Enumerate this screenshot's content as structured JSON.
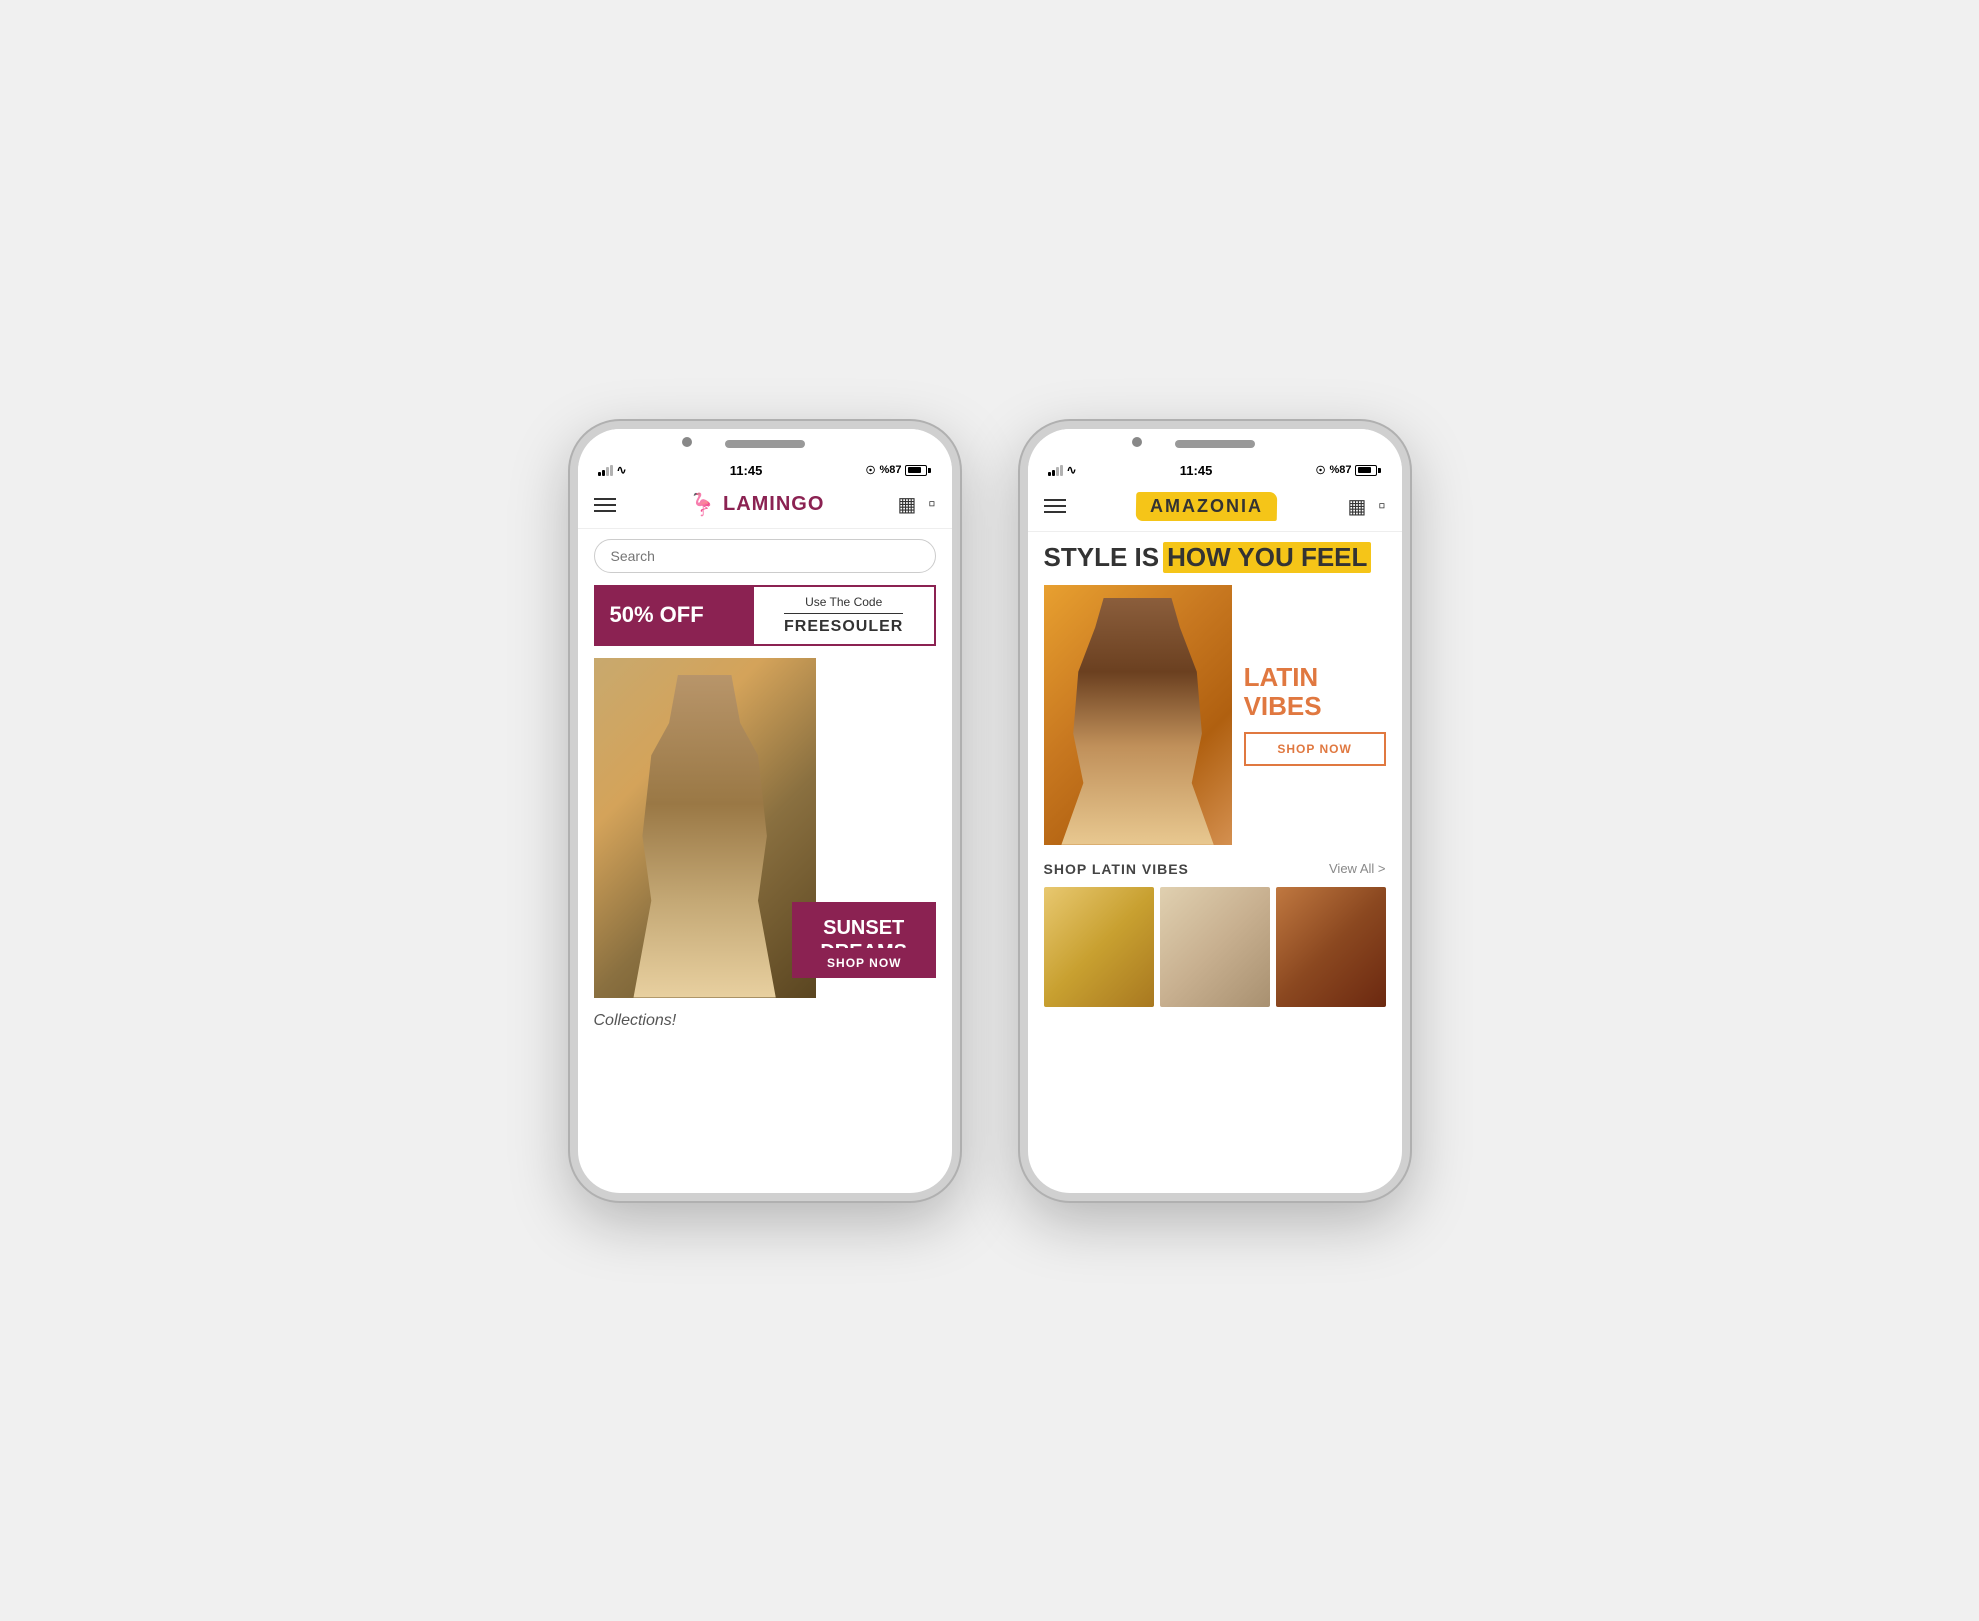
{
  "phones": {
    "lamingo": {
      "status": {
        "time": "11:45",
        "battery_pct": "%87"
      },
      "header": {
        "logo_text": "LAMINGO",
        "menu_label": "Menu",
        "chat_icon": "chat-icon",
        "bag_icon": "bag-icon"
      },
      "search": {
        "placeholder": "Search"
      },
      "promo": {
        "discount": "50% OFF",
        "code_label": "Use The Code",
        "code": "FREESOULER"
      },
      "collection": {
        "title_line1": "SUNSET",
        "title_line2": "DREAMS",
        "cta": "SHOP NOW"
      },
      "footer_label": "Collections!"
    },
    "amazonia": {
      "status": {
        "time": "11:45",
        "battery_pct": "%87"
      },
      "header": {
        "logo_text": "AMAZONIA",
        "menu_label": "Menu",
        "chat_icon": "chat-icon",
        "bag_icon": "bag-icon"
      },
      "headline": {
        "part1": "STYLE IS",
        "part2": "HOW YOU FEEL"
      },
      "campaign": {
        "title_line1": "LATIN",
        "title_line2": "VIBES",
        "cta": "SHOP NOW"
      },
      "collection": {
        "label": "SHOP LATIN VIBES",
        "view_all": "View All >"
      }
    }
  }
}
